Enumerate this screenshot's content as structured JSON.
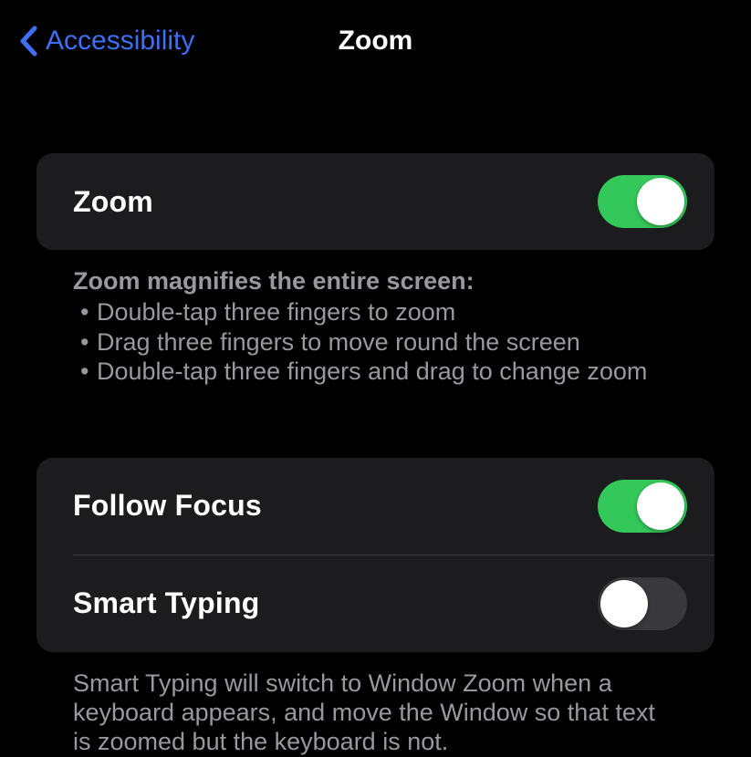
{
  "header": {
    "back_label": "Accessibility",
    "title": "Zoom"
  },
  "sections": {
    "zoom": {
      "label": "Zoom",
      "enabled": true,
      "footer_header": "Zoom magnifies the entire screen:",
      "footer_items": [
        "Double-tap three fingers to zoom",
        "Drag three fingers to move round the screen",
        "Double-tap three fingers and drag to change zoom"
      ]
    },
    "focus": {
      "follow_focus_label": "Follow Focus",
      "follow_focus_enabled": true,
      "smart_typing_label": "Smart Typing",
      "smart_typing_enabled": false,
      "footer_text": "Smart Typing will switch to Window Zoom when a keyboard appears, and move the Window so that text is zoomed but the keyboard is not."
    }
  }
}
